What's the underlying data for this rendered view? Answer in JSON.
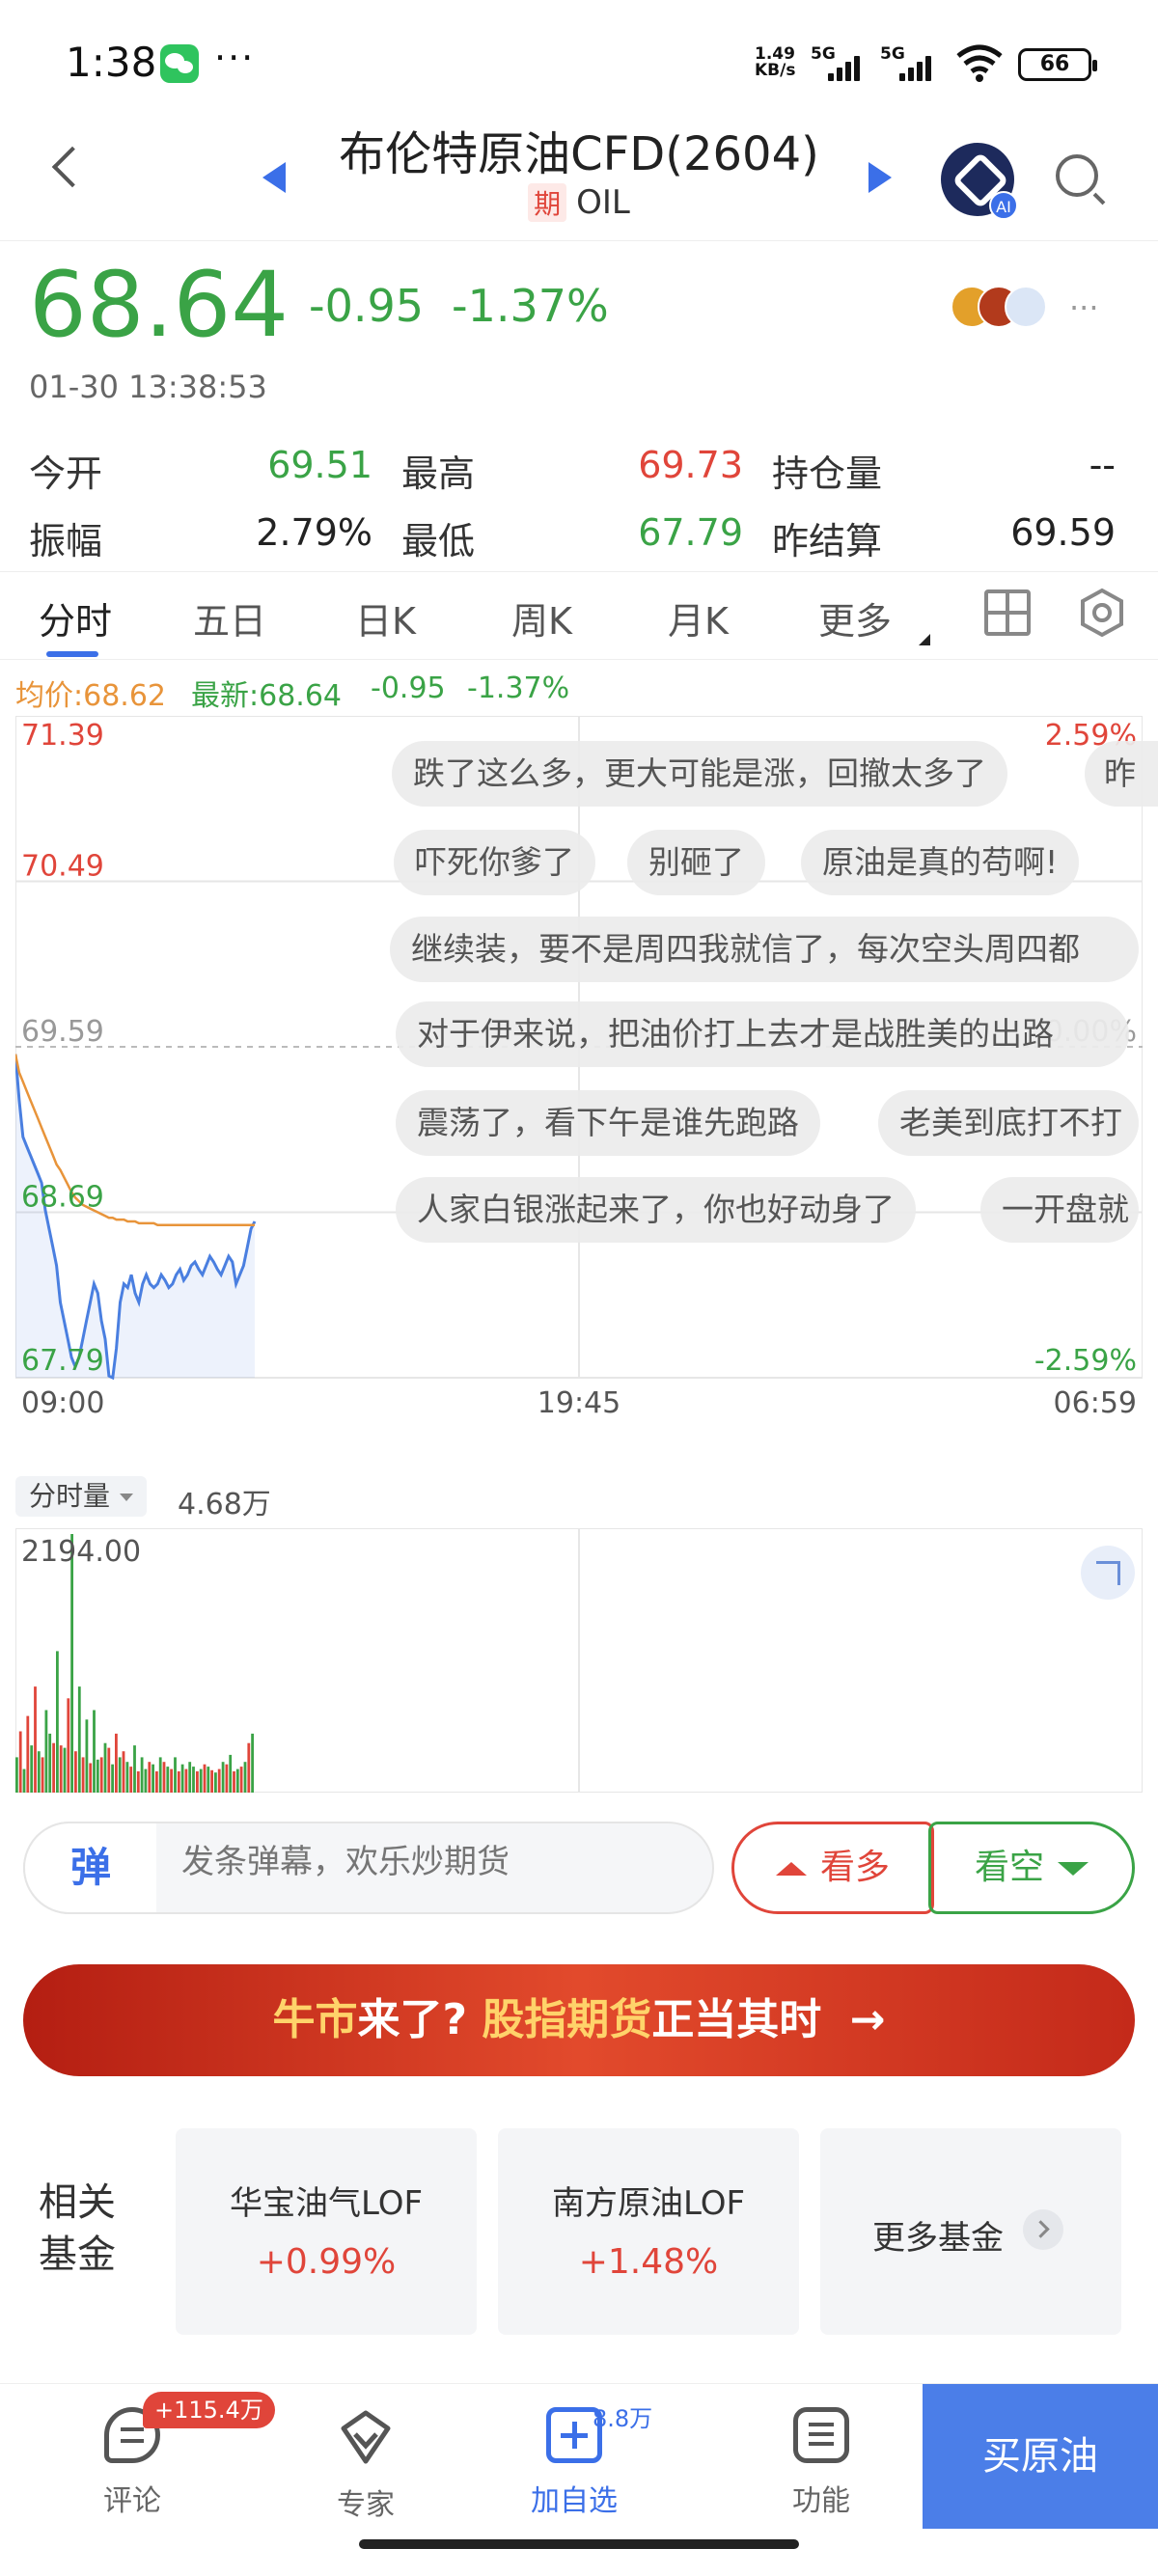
{
  "status_bar": {
    "time": "1:38",
    "more": "···",
    "net_speed_top": "1.49",
    "net_speed_unit": "KB/s",
    "signal_1": "5G",
    "signal_2": "5G",
    "battery": "66"
  },
  "header": {
    "title": "布伦特原油CFD(2604)",
    "tag": "期",
    "symbol": "OIL"
  },
  "quote": {
    "price": "68.64",
    "change": "-0.95",
    "change_pct": "-1.37%",
    "datetime": "01-30 13:38:53",
    "more": "···",
    "colors": {
      "up": "#e0453a",
      "down": "#3aa346",
      "accent": "#3b6fe8"
    }
  },
  "stats": [
    {
      "label": "今开",
      "value": "69.51",
      "color": "green"
    },
    {
      "label": "最高",
      "value": "69.73",
      "color": "red"
    },
    {
      "label": "持仓量",
      "value": "--",
      "color": "dark"
    },
    {
      "label": "振幅",
      "value": "2.79%",
      "color": "dark"
    },
    {
      "label": "最低",
      "value": "67.79",
      "color": "green"
    },
    {
      "label": "昨结算",
      "value": "69.59",
      "color": "dark"
    }
  ],
  "tabs": [
    "分时",
    "五日",
    "日K",
    "周K",
    "月K",
    "更多"
  ],
  "legend": {
    "avg": "均价:68.62",
    "latest": "最新:68.64",
    "change": "-0.95",
    "pct": "-1.37%"
  },
  "chart_data": {
    "type": "line",
    "y_left_labels": [
      "71.39",
      "70.49",
      "69.59",
      "68.69",
      "67.79"
    ],
    "y_right_labels": [
      "2.59%",
      "0.00%",
      "-2.59%"
    ],
    "x_labels": [
      "09:00",
      "19:45",
      "06:59"
    ],
    "prev_settle": 69.59,
    "ylim": [
      67.79,
      71.39
    ],
    "series": [
      {
        "name": "最新",
        "color": "#4a7fe0",
        "values": [
          69.55,
          69.3,
          69.1,
          69.05,
          69.0,
          68.95,
          68.9,
          68.85,
          68.7,
          68.6,
          68.5,
          68.4,
          68.2,
          68.1,
          68.0,
          67.9,
          67.85,
          67.9,
          68.0,
          68.1,
          68.2,
          68.3,
          68.25,
          68.1,
          68.0,
          67.8,
          67.79,
          67.95,
          68.2,
          68.3,
          68.28,
          68.35,
          68.25,
          68.2,
          68.3,
          68.35,
          68.3,
          68.28,
          68.3,
          68.35,
          68.32,
          68.28,
          68.3,
          68.35,
          68.38,
          68.32,
          68.35,
          68.4,
          68.42,
          68.38,
          68.35,
          68.4,
          68.45,
          68.42,
          68.38,
          68.35,
          68.4,
          68.45,
          68.42,
          68.3,
          68.35,
          68.4,
          68.5,
          68.6,
          68.64
        ]
      },
      {
        "name": "均价",
        "color": "#e8943a",
        "values": [
          69.55,
          69.45,
          69.4,
          69.35,
          69.3,
          69.25,
          69.2,
          69.15,
          69.1,
          69.05,
          69.0,
          68.95,
          68.92,
          68.88,
          68.84,
          68.8,
          68.77,
          68.75,
          68.73,
          68.72,
          68.71,
          68.7,
          68.69,
          68.68,
          68.67,
          68.66,
          68.66,
          68.65,
          68.65,
          68.65,
          68.64,
          68.64,
          68.64,
          68.63,
          68.63,
          68.63,
          68.63,
          68.63,
          68.62,
          68.62,
          68.62,
          68.62,
          68.62,
          68.62,
          68.62,
          68.62,
          68.62,
          68.62,
          68.62,
          68.62,
          68.62,
          68.62,
          68.62,
          68.62,
          68.62,
          68.62,
          68.62,
          68.62,
          68.62,
          68.62,
          68.62,
          68.62,
          68.62,
          68.62,
          68.62
        ]
      }
    ],
    "volume": {
      "max_label": "2194.00",
      "max": 2194,
      "values": [
        300,
        520,
        200,
        650,
        400,
        900,
        350,
        300,
        700,
        500,
        420,
        1200,
        400,
        380,
        800,
        2194,
        350,
        900,
        300,
        620,
        250,
        700,
        280,
        300,
        420,
        380,
        240,
        500,
        300,
        350,
        260,
        220,
        400,
        180,
        300,
        200,
        260,
        240,
        180,
        300,
        260,
        220,
        200,
        300,
        180,
        240,
        200,
        260,
        220,
        180,
        200,
        240,
        220,
        190,
        170,
        200,
        260,
        240,
        320,
        180,
        200,
        220,
        260,
        420,
        500
      ],
      "colors": [
        "g",
        "r",
        "g",
        "r",
        "g",
        "r",
        "g",
        "r",
        "g",
        "g",
        "r",
        "g",
        "r",
        "g",
        "r",
        "g",
        "r",
        "g",
        "r",
        "g",
        "r",
        "g",
        "g",
        "r",
        "g",
        "r",
        "g",
        "r",
        "g",
        "r",
        "g",
        "r",
        "g",
        "r",
        "g",
        "g",
        "r",
        "g",
        "r",
        "g",
        "r",
        "g",
        "r",
        "g",
        "r",
        "g",
        "r",
        "g",
        "g",
        "r",
        "g",
        "r",
        "g",
        "r",
        "g",
        "r",
        "g",
        "r",
        "g",
        "r",
        "g",
        "r",
        "g",
        "r",
        "g"
      ]
    }
  },
  "danmaku": [
    "跌了这么多，更大可能是涨，回撤太多了",
    "昨",
    "吓死你爹了",
    "别砸了",
    "原油是真的苟啊!",
    "继续装，要不是周四我就信了，每次空头周四都",
    "对于伊来说，把油价打上去才是战胜美的出路",
    "震荡了，看下午是谁先跑路",
    "老美到底打不打",
    "人家白银涨起来了，你也好动身了",
    "一开盘就"
  ],
  "volume_panel": {
    "tag": "分时量",
    "total": "4.68万"
  },
  "danmu_input": {
    "icon_label": "弹",
    "placeholder": "发条弹幕，欢乐炒期货",
    "bull": "看多",
    "bear": "看空"
  },
  "banner": {
    "part1": "牛市",
    "part2": "来了? ",
    "part3": "股指期货",
    "part4": "正当其时",
    "arrow": "→"
  },
  "funds": {
    "label": "相关基金",
    "items": [
      {
        "name": "华宝油气LOF",
        "change": "+0.99%"
      },
      {
        "name": "南方原油LOF",
        "change": "+1.48%"
      }
    ],
    "more": "更多基金"
  },
  "bottom_nav": {
    "comment": "评论",
    "comment_badge": "+115.4万",
    "expert": "专家",
    "watch": "加自选",
    "watch_badge": "8.8万",
    "functions": "功能",
    "buy": "买原油"
  }
}
